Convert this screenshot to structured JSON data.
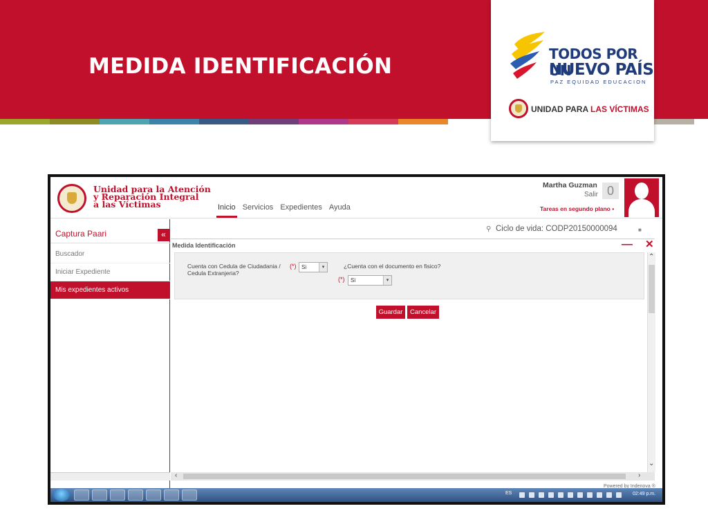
{
  "slide": {
    "title": "MEDIDA IDENTIFICACIÓN",
    "stripe_colors": [
      "#9aa72a",
      "#8d8c23",
      "#4ea4b0",
      "#3d83a8",
      "#3a5a86",
      "#6f3f7a",
      "#b0388a",
      "#d63a55",
      "#e9872a",
      "#ffffff",
      "#c0102b",
      "#c0102b",
      "#b8b0a4"
    ]
  },
  "logo": {
    "line1": "TODOS POR UN",
    "line2": "NUEVO PAÍS",
    "tagline": "PAZ  EQUIDAD  EDUCACION",
    "unidad_prefix": "UNIDAD PARA ",
    "unidad_strong": "LAS VÍCTIMAS"
  },
  "app": {
    "institution": {
      "line1": "Unidad para la Atención",
      "line2": "y Reparación Integral",
      "line3": "a las Víctimas"
    },
    "nav": [
      "Inicio",
      "Servicios",
      "Expedientes",
      "Ayuda"
    ],
    "user": {
      "name": "Martha Guzman",
      "logout": "Salir",
      "badge": "0",
      "background_tasks": "Tareas en segundo plano"
    },
    "sidebar": {
      "title": "Captura Paari",
      "collapse": "«",
      "items": [
        {
          "label": "Buscador"
        },
        {
          "label": "Iniciar Expediente"
        },
        {
          "label": "Mis expedientes activos"
        }
      ]
    },
    "lifecycle": "Ciclo de vida: CODP20150000094",
    "panel": {
      "title": "Medida Identificación",
      "minimize": "—",
      "close": "✕"
    },
    "form": {
      "q1_label": "Cuenta con Cedula de Ciudadania / Cedula Extranjeria?",
      "q1_required": "(*)",
      "q1_value": "Si",
      "q2_label": "¿Cuenta con el documento en fisico?",
      "q2_required": "(*)",
      "q2_value": "Si"
    },
    "buttons": {
      "save": "Guardar",
      "cancel": "Cancelar"
    },
    "powered_by": "Powered by Indenova ®",
    "taskbar": {
      "lang": "ES",
      "clock": "02:49 p.m."
    }
  },
  "colors": {
    "brand_red": "#c0102b",
    "logo_blue": "#1f3b7a"
  }
}
